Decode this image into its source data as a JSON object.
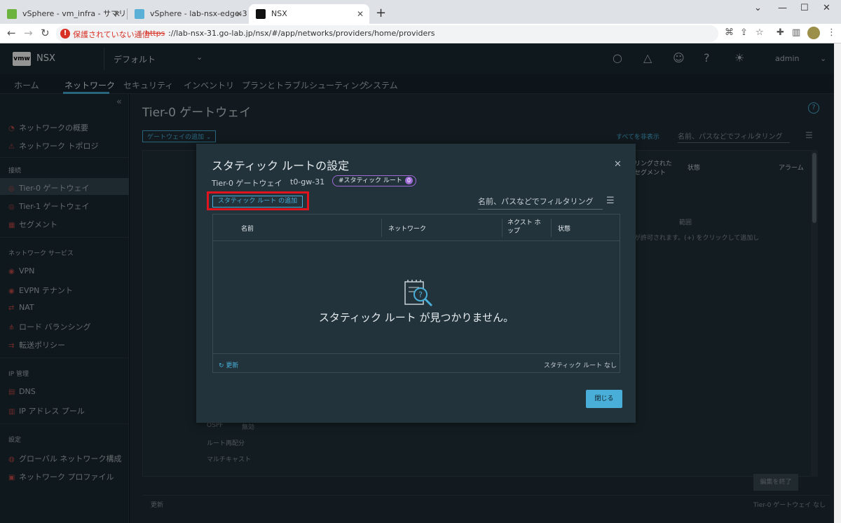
{
  "browser": {
    "tabs": [
      {
        "title": "vSphere - vm_infra - サマリ"
      },
      {
        "title": "vSphere - lab-nsx-edge-31 - サマ"
      },
      {
        "title": "NSX"
      }
    ],
    "security_warning": "保護されていない通信",
    "url_scheme": "https",
    "url_rest": "://lab-nsx-31.go-lab.jp/nsx/#/app/networks/providers/home/providers",
    "colors": {
      "warning": "#d93025"
    }
  },
  "header": {
    "logo": "vmw",
    "app_name": "NSX",
    "context": "デフォルト",
    "user": "admin"
  },
  "nav": {
    "tabs": [
      "ホーム",
      "ネットワーク",
      "セキュリティ",
      "インベントリ",
      "プランとトラブルシューティング",
      "システム"
    ],
    "active": "ネットワーク"
  },
  "sidebar": {
    "items": [
      "ネットワークの概要",
      "ネットワーク トポロジ",
      "Tier-0 ゲートウェイ",
      "Tier-1 ゲートウェイ",
      "セグメント",
      "VPN",
      "EVPN テナント",
      "NAT",
      "ロード バランシング",
      "転送ポリシー",
      "DNS",
      "IP アドレス プール",
      "グローバル ネットワーク構成",
      "ネットワーク プロファイル"
    ],
    "headers": [
      "接続",
      "ネットワーク サービス",
      "IP 管理",
      "設定"
    ]
  },
  "background": {
    "page_title": "Tier-0 ゲートウェイ",
    "add_gateway": "ゲートウェイの追加 ⌄",
    "show_all": "すべてを非表示",
    "filter_placeholder": "名前、パスなどでフィルタリング",
    "col_segment": "リングされた セグメント",
    "col_status": "状態",
    "col_alarm": "アラーム",
    "range": "範囲",
    "hint": "が許可されます。(+) をクリックして追加し",
    "ospf": "OSPF",
    "ospf_state": "無効",
    "route_redist": "ルート再配分",
    "multicast": "マルチキャスト",
    "end_edit": "編集を終了",
    "refresh": "更新",
    "footer_count": "Tier-0 ゲートウェイ なし"
  },
  "modal": {
    "title": "スタティック ルートの設定",
    "gateway_label": "Tier-0 ゲートウェイ",
    "gateway_name": "t0-gw-31",
    "tag_label": "#スタティック ルート",
    "tag_count": "0",
    "add_button": "スタティック ルート の追加",
    "filter_placeholder": "名前、パスなどでフィルタリング",
    "columns": [
      "名前",
      "ネットワーク",
      "ネクスト ホップ",
      "状態"
    ],
    "empty_text": "スタティック ルート が見つかりません。",
    "refresh": "更新",
    "count_text": "スタティック ルート なし",
    "close_button": "閉じる",
    "colors": {
      "accent": "#49afd9",
      "highlight": "#e0141e",
      "tag": "#a06ad6"
    }
  }
}
